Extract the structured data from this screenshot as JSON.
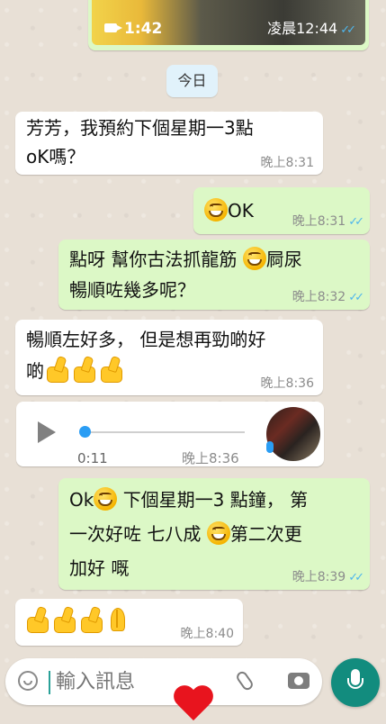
{
  "video_message": {
    "duration": "1:42",
    "time": "凌晨12:44"
  },
  "date_chip": "今日",
  "messages": [
    {
      "line1": "芳芳，我預約下個星期一3點",
      "line2": "oK嗎？",
      "time": "晚上8:31"
    },
    {
      "text": "OK",
      "time": "晚上8:31"
    },
    {
      "line1_a": "點呀 幫你古法抓龍筋",
      "line1_b": "屙尿",
      "line2": "暢順咗幾多呢？",
      "time": "晚上8:32"
    },
    {
      "line1": "暢順左好多， 但是想再勁啲好",
      "line2": "啲",
      "time": "晚上8:36"
    },
    {
      "line1_a": "Ok",
      "line1_b": "下個星期一3 點鐘， 第",
      "line2_a": "一次好咗 七八成",
      "line2_b": "第二次更",
      "line3": "加好 嘅",
      "time": "晚上8:39"
    },
    {
      "time": "晚上8:40"
    }
  ],
  "voice_message": {
    "duration": "0:11",
    "time": "晚上8:36"
  },
  "input": {
    "placeholder": "輸入訊息"
  },
  "colors": {
    "incoming": "#ffffff",
    "outgoing": "#dcf8c6",
    "send_button": "#128c7e",
    "read_ticks": "#4fb6ec"
  },
  "icons": [
    "video-camera-icon",
    "double-check-icon",
    "play-icon",
    "mic-icon",
    "emoji-icon",
    "attach-icon",
    "camera-icon",
    "heart-icon"
  ]
}
